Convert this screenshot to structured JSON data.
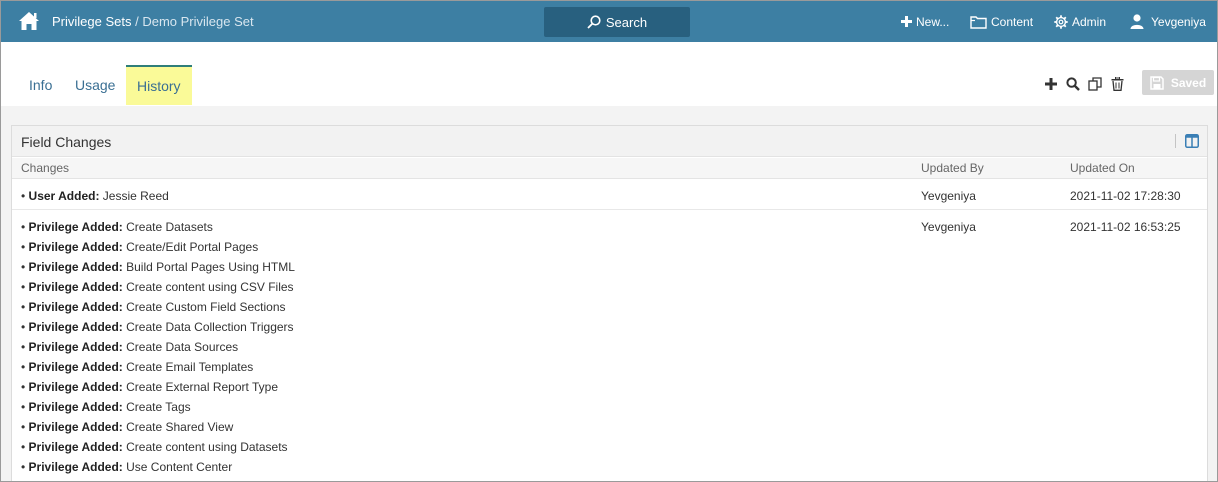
{
  "topbar": {
    "breadcrumb_root": "Privilege Sets",
    "breadcrumb_sep": " / ",
    "breadcrumb_current": "Demo Privilege Set",
    "search_label": "Search",
    "new_label": "New...",
    "content_label": "Content",
    "admin_label": "Admin",
    "user_label": "Yevgeniya"
  },
  "tabs": [
    {
      "label": "Info"
    },
    {
      "label": "Usage"
    },
    {
      "label": "History"
    }
  ],
  "toolbar": {
    "saved_label": "Saved"
  },
  "panel": {
    "title": "Field Changes",
    "columns": {
      "changes": "Changes",
      "updated_by": "Updated By",
      "updated_on": "Updated On"
    },
    "rows": [
      {
        "changes": [
          {
            "bullet": "• ",
            "label": "User Added:",
            "value": " Jessie Reed"
          }
        ],
        "updated_by": "Yevgeniya",
        "updated_on": "2021-11-02 17:28:30"
      },
      {
        "changes": [
          {
            "bullet": "• ",
            "label": "Privilege Added:",
            "value": " Create Datasets"
          },
          {
            "bullet": "• ",
            "label": "Privilege Added:",
            "value": " Create/Edit Portal Pages"
          },
          {
            "bullet": "• ",
            "label": "Privilege Added:",
            "value": " Build Portal Pages Using HTML"
          },
          {
            "bullet": "• ",
            "label": "Privilege Added:",
            "value": " Create content using CSV Files"
          },
          {
            "bullet": "• ",
            "label": "Privilege Added:",
            "value": " Create Custom Field Sections"
          },
          {
            "bullet": "• ",
            "label": "Privilege Added:",
            "value": " Create Data Collection Triggers"
          },
          {
            "bullet": "• ",
            "label": "Privilege Added:",
            "value": " Create Data Sources"
          },
          {
            "bullet": "• ",
            "label": "Privilege Added:",
            "value": " Create Email Templates"
          },
          {
            "bullet": "• ",
            "label": "Privilege Added:",
            "value": " Create External Report Type"
          },
          {
            "bullet": "• ",
            "label": "Privilege Added:",
            "value": " Create Tags"
          },
          {
            "bullet": "• ",
            "label": "Privilege Added:",
            "value": " Create Shared View"
          },
          {
            "bullet": "• ",
            "label": "Privilege Added:",
            "value": " Create content using Datasets"
          },
          {
            "bullet": "• ",
            "label": "Privilege Added:",
            "value": " Use Content Center"
          }
        ],
        "updated_by": "Yevgeniya",
        "updated_on": "2021-11-02 16:53:25"
      }
    ]
  },
  "colors": {
    "topbar": "#3d7fa3",
    "search_button": "#28607f",
    "active_tab": "#fafa98",
    "link": "#3a6f93"
  }
}
